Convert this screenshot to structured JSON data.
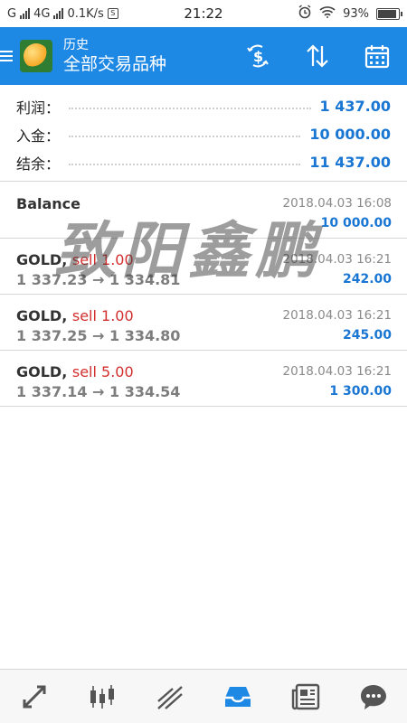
{
  "status_bar": {
    "network": "G",
    "network2": "4G",
    "speed": "0.1K/s",
    "time": "21:22",
    "battery": "93%",
    "battery_level": 0.93
  },
  "app_bar": {
    "subtitle": "历史",
    "title": "全部交易品种",
    "icons": [
      "menu-icon",
      "app-logo",
      "dollar-swap-icon",
      "sort-icon",
      "calendar-icon"
    ]
  },
  "summary": [
    {
      "label": "利润：",
      "value": "1 437.00"
    },
    {
      "label": "入金：",
      "value": "10 000.00"
    },
    {
      "label": "结余：",
      "value": "11 437.00"
    }
  ],
  "deals": [
    {
      "symbol": "Balance",
      "action": "",
      "prices": "",
      "time": "2018.04.03 16:08",
      "profit": "10 000.00"
    },
    {
      "symbol": "GOLD, ",
      "action": "sell 1.00",
      "prices": "1 337.23 → 1 334.81",
      "time": "2018.04.03 16:21",
      "profit": "242.00"
    },
    {
      "symbol": "GOLD, ",
      "action": "sell 1.00",
      "prices": "1 337.25 → 1 334.80",
      "time": "2018.04.03 16:21",
      "profit": "245.00"
    },
    {
      "symbol": "GOLD, ",
      "action": "sell 5.00",
      "prices": "1 337.14 → 1 334.54",
      "time": "2018.04.03 16:21",
      "profit": "1 300.00"
    }
  ],
  "watermark": "致阳鑫鹏",
  "bottom_nav": [
    "trade-icon",
    "chart-candles-icon",
    "trend-icon",
    "history-inbox-icon",
    "news-icon",
    "chat-icon"
  ],
  "colors": {
    "accent": "#1e88e5",
    "value": "#1976d2",
    "sell": "#d32f2f",
    "active_nav": "#1e88e5"
  }
}
